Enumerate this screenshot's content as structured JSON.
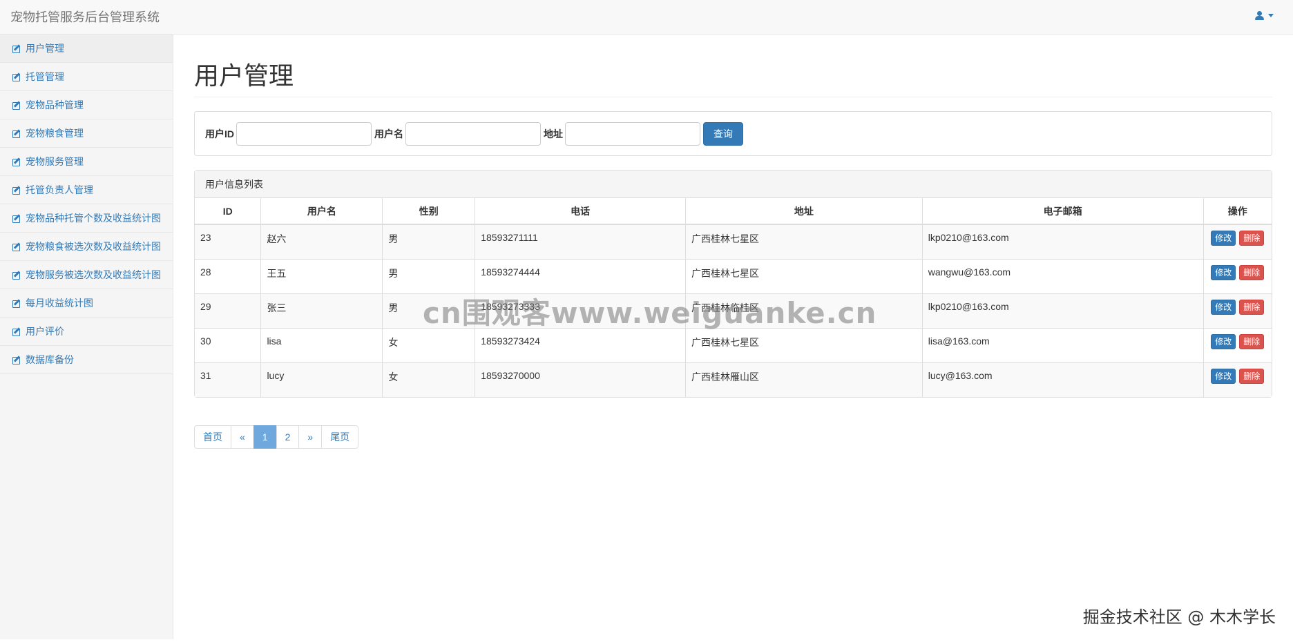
{
  "app": {
    "title": "宠物托管服务后台管理系统"
  },
  "sidebar": {
    "items": [
      {
        "label": "用户管理",
        "active": true
      },
      {
        "label": "托管管理"
      },
      {
        "label": "宠物品种管理"
      },
      {
        "label": "宠物粮食管理"
      },
      {
        "label": "宠物服务管理"
      },
      {
        "label": "托管负责人管理"
      },
      {
        "label": "宠物品种托管个数及收益统计图"
      },
      {
        "label": "宠物粮食被选次数及收益统计图"
      },
      {
        "label": "宠物服务被选次数及收益统计图"
      },
      {
        "label": "每月收益统计图"
      },
      {
        "label": "用户评价"
      },
      {
        "label": "数据库备份"
      }
    ]
  },
  "main": {
    "page_title": "用户管理",
    "search": {
      "user_id_label": "用户ID",
      "user_id_value": "",
      "username_label": "用户名",
      "username_value": "",
      "address_label": "地址",
      "address_value": "",
      "query_button": "查询"
    },
    "table": {
      "heading": "用户信息列表",
      "columns": [
        "ID",
        "用户名",
        "性别",
        "电话",
        "地址",
        "电子邮箱",
        "操作"
      ],
      "rows": [
        {
          "id": "23",
          "username": "赵六",
          "gender": "男",
          "phone": "18593271111",
          "address": "广西桂林七星区",
          "email": "lkp0210@163.com"
        },
        {
          "id": "28",
          "username": "王五",
          "gender": "男",
          "phone": "18593274444",
          "address": "广西桂林七星区",
          "email": "wangwu@163.com"
        },
        {
          "id": "29",
          "username": "张三",
          "gender": "男",
          "phone": "18593273333",
          "address": "广西桂林临桂区",
          "email": "lkp0210@163.com"
        },
        {
          "id": "30",
          "username": "lisa",
          "gender": "女",
          "phone": "18593273424",
          "address": "广西桂林七星区",
          "email": "lisa@163.com"
        },
        {
          "id": "31",
          "username": "lucy",
          "gender": "女",
          "phone": "18593270000",
          "address": "广西桂林雁山区",
          "email": "lucy@163.com"
        }
      ],
      "edit_label": "修改",
      "delete_label": "删除"
    },
    "pagination": {
      "first": "首页",
      "prev": "«",
      "pages": [
        "1",
        "2"
      ],
      "current": "1",
      "next": "»",
      "last": "尾页"
    }
  },
  "watermarks": {
    "center": "cn围观客www.weiguanke.cn",
    "corner": "掘金技术社区 @ 木木学长"
  },
  "colors": {
    "link": "#337ab7",
    "danger": "#d9534f",
    "active_page": "#6fa8dc"
  }
}
